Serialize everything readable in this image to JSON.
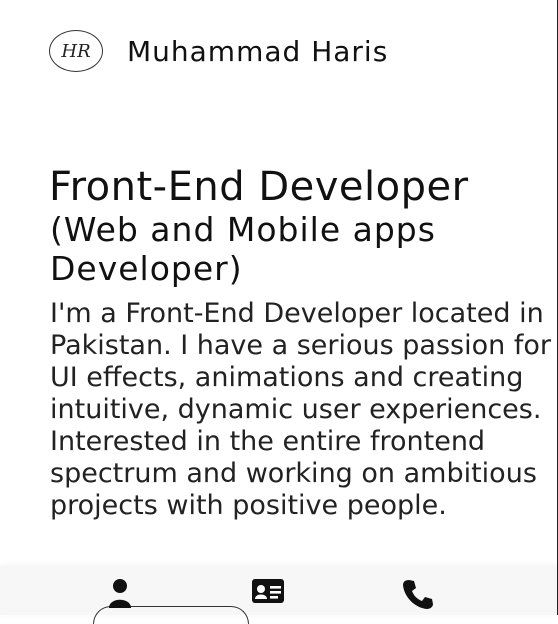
{
  "header": {
    "logo_text": "HR",
    "site_name": "Muhammad Haris"
  },
  "hero": {
    "title": "Front-End Developer",
    "subtitle": "(Web and Mobile apps Developer)"
  },
  "bio": {
    "paragraph_1": "I'm a Front-End Developer located in Pakistan. I have a serious passion for UI effects, animations and creating intuitive, dynamic user experiences.",
    "paragraph_2": "Interested in the entire frontend spectrum and working on ambitious projects with positive people."
  },
  "bottom_nav": {
    "items": [
      {
        "icon": "user-icon"
      },
      {
        "icon": "contact-card-icon"
      },
      {
        "icon": "phone-icon"
      }
    ],
    "active_index": 0
  },
  "colors": {
    "background": "#ffffff",
    "text": "#111111",
    "nav_background": "#f5f5f5"
  }
}
